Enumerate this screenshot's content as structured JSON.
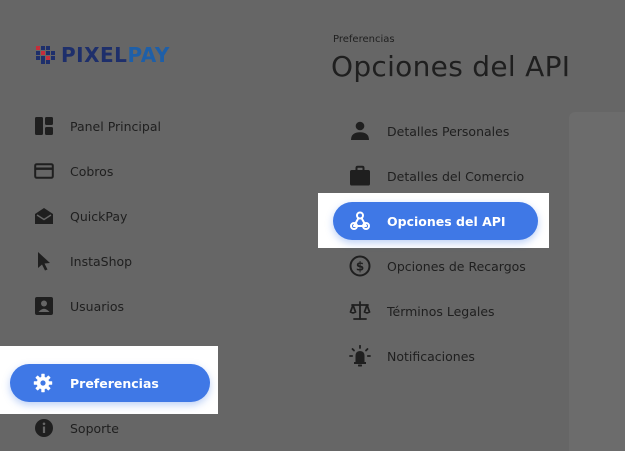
{
  "logo": {
    "text_part1": "PIXEL",
    "text_part2": "PAY"
  },
  "sidebar": {
    "items": [
      {
        "label": "Panel Principal",
        "icon": "dashboard-icon"
      },
      {
        "label": "Cobros",
        "icon": "credit-card-icon"
      },
      {
        "label": "QuickPay",
        "icon": "open-envelope-icon"
      },
      {
        "label": "InstaShop",
        "icon": "cursor-pointer-icon"
      },
      {
        "label": "Usuarios",
        "icon": "user-badge-icon"
      },
      {
        "label": "Preferencias",
        "icon": "gear-icon",
        "active": true
      },
      {
        "label": "Soporte",
        "icon": "info-icon"
      }
    ]
  },
  "header": {
    "breadcrumb": "Preferencias",
    "title": "Opciones del API"
  },
  "submenu": {
    "items": [
      {
        "label": "Detalles Personales",
        "icon": "person-icon"
      },
      {
        "label": "Detalles del Comercio",
        "icon": "briefcase-icon"
      },
      {
        "label": "Opciones del API",
        "icon": "webhook-icon",
        "active": true
      },
      {
        "label": "Opciones de Recargos",
        "icon": "dollar-circle-icon"
      },
      {
        "label": "Términos Legales",
        "icon": "scales-icon"
      },
      {
        "label": "Notificaciones",
        "icon": "bell-light-icon"
      }
    ]
  },
  "colors": {
    "overlay": "#666666",
    "accent": "#3f78e6",
    "logo_dark": "#1e2f6b",
    "logo_blue": "#1e5fa8"
  }
}
